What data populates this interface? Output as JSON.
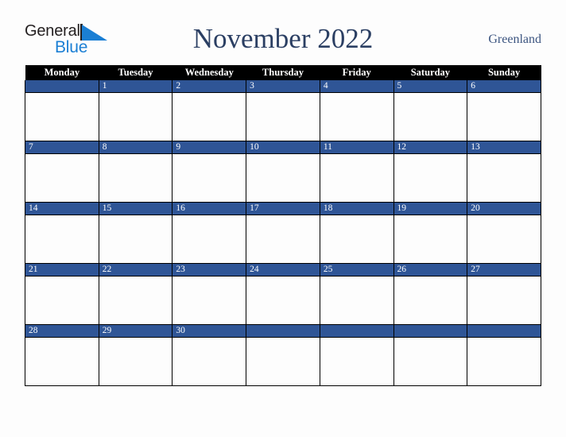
{
  "logo": {
    "word_one": "General",
    "word_two": "Blue",
    "triangle_icon": "triangle-icon",
    "color_dark": "#231f20",
    "color_blue": "#1b7fd4"
  },
  "header": {
    "title": "November 2022",
    "country": "Greenland",
    "title_color": "#2b3f63",
    "country_color": "#3c5580"
  },
  "calendar": {
    "header_bg": "#000000",
    "header_text_color": "#ffffff",
    "daynum_band_color": "#2f5596",
    "daynum_text_color": "#ffffff",
    "cell_bg": "#fdfdfd",
    "border_color": "#000000",
    "weekday_headers": [
      "Monday",
      "Tuesday",
      "Wednesday",
      "Thursday",
      "Friday",
      "Saturday",
      "Sunday"
    ],
    "weeks": [
      [
        {
          "day": ""
        },
        {
          "day": "1"
        },
        {
          "day": "2"
        },
        {
          "day": "3"
        },
        {
          "day": "4"
        },
        {
          "day": "5"
        },
        {
          "day": "6"
        }
      ],
      [
        {
          "day": "7"
        },
        {
          "day": "8"
        },
        {
          "day": "9"
        },
        {
          "day": "10"
        },
        {
          "day": "11"
        },
        {
          "day": "12"
        },
        {
          "day": "13"
        }
      ],
      [
        {
          "day": "14"
        },
        {
          "day": "15"
        },
        {
          "day": "16"
        },
        {
          "day": "17"
        },
        {
          "day": "18"
        },
        {
          "day": "19"
        },
        {
          "day": "20"
        }
      ],
      [
        {
          "day": "21"
        },
        {
          "day": "22"
        },
        {
          "day": "23"
        },
        {
          "day": "24"
        },
        {
          "day": "25"
        },
        {
          "day": "26"
        },
        {
          "day": "27"
        }
      ],
      [
        {
          "day": "28"
        },
        {
          "day": "29"
        },
        {
          "day": "30"
        },
        {
          "day": ""
        },
        {
          "day": ""
        },
        {
          "day": ""
        },
        {
          "day": ""
        }
      ]
    ]
  }
}
